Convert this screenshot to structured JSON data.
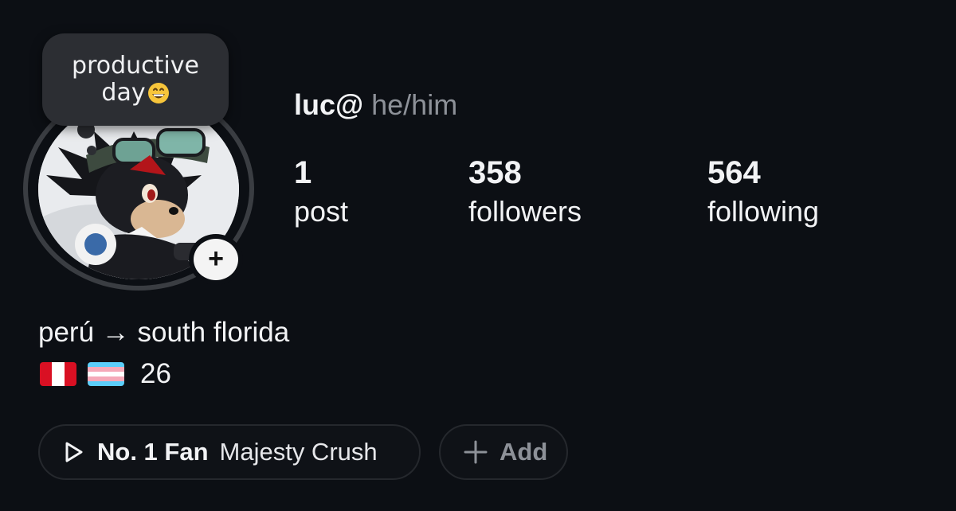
{
  "profile": {
    "username": "luc@",
    "pronouns": "he/him"
  },
  "note": {
    "line1": "productive",
    "line2": "day",
    "emoji": "grinning-face-emoji"
  },
  "stats": {
    "posts": {
      "value": "1",
      "label": "post"
    },
    "followers": {
      "value": "358",
      "label": "followers"
    },
    "following": {
      "value": "564",
      "label": "following"
    }
  },
  "bio": {
    "line1": "perú → south florida",
    "flags": [
      "peru-flag",
      "transgender-flag"
    ],
    "age": "26"
  },
  "music": {
    "icon": "play-icon",
    "bold_label": "No. 1 Fan",
    "title": "Majesty Crush"
  },
  "add_button": {
    "icon": "plus-icon",
    "label": "Add"
  },
  "colors": {
    "background": "#0c0f14",
    "note_bubble": "#2c2e33",
    "ring": "#3a3d42",
    "muted_text": "#8d9198"
  }
}
